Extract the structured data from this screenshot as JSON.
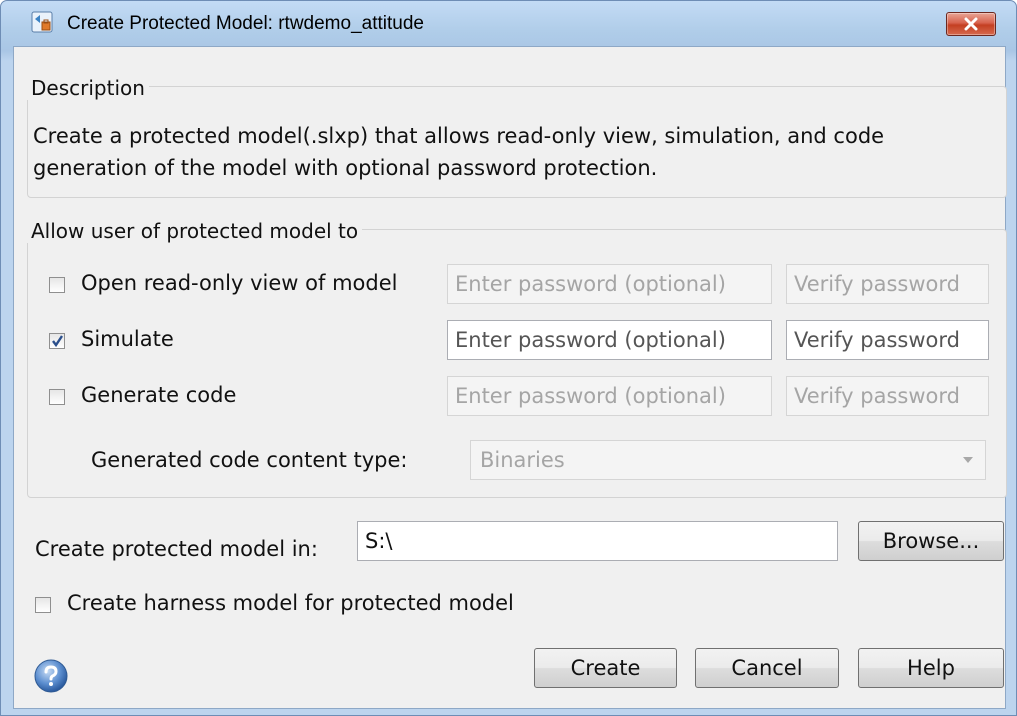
{
  "window": {
    "title": "Create Protected Model: rtwdemo_attitude",
    "close_icon": "close-x-icon",
    "app_icon": "simulink-model-icon"
  },
  "description": {
    "legend": "Description",
    "text": "Create a protected model(.slxp) that allows read-only view, simulation, and code generation of the model with optional password protection."
  },
  "permissions": {
    "legend": "Allow user of protected model to",
    "rows": [
      {
        "label": "Open read-only view of model",
        "checked": false,
        "enabled": false,
        "password_placeholder": "Enter password (optional)",
        "verify_placeholder": "Verify password"
      },
      {
        "label": "Simulate",
        "checked": true,
        "enabled": true,
        "password_placeholder": "Enter password (optional)",
        "verify_placeholder": "Verify password"
      },
      {
        "label": "Generate code",
        "checked": false,
        "enabled": false,
        "password_placeholder": "Enter password (optional)",
        "verify_placeholder": "Verify password"
      }
    ],
    "content_type_label": "Generated code content type:",
    "content_type_value": "Binaries"
  },
  "location": {
    "label": "Create protected model in:",
    "value": "S:\\",
    "browse_label": "Browse..."
  },
  "harness": {
    "label": "Create harness model for protected model",
    "checked": false
  },
  "footer": {
    "help_icon": "question-mark-icon",
    "create_label": "Create",
    "cancel_label": "Cancel",
    "help_label": "Help"
  }
}
